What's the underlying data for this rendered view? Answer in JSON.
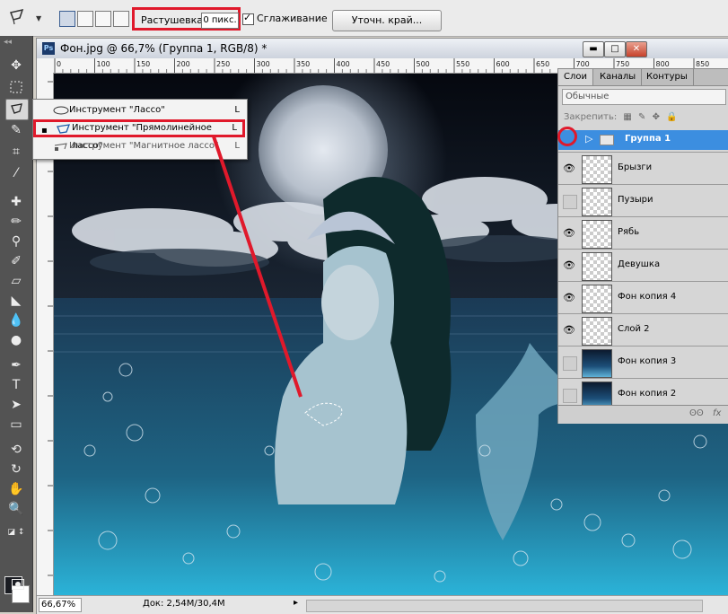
{
  "options_bar": {
    "feather_label": "Растушевка:",
    "feather_value": "0 пикс.",
    "antialias_label": "Сглаживание",
    "antialias_checked": true,
    "refine_edge_label": "Уточн. край..."
  },
  "document": {
    "title": "Фон.jpg @ 66,7% (Группа 1, RGB/8) *",
    "ruler_labels": [
      "0",
      "100",
      "150",
      "200",
      "250",
      "300",
      "350",
      "400",
      "450",
      "500",
      "550",
      "600",
      "650",
      "700",
      "750",
      "800",
      "850"
    ],
    "zoom": "66,67%",
    "doc_info": "Док: 2,54M/30,4M"
  },
  "tool_flyout": {
    "items": [
      {
        "label": "Инструмент \"Лассо\"",
        "shortcut": "L",
        "selected": false
      },
      {
        "label": "Инструмент \"Прямолинейное лассо\"",
        "shortcut": "L",
        "selected": true
      },
      {
        "label": "Инструмент \"Магнитное лассо\"",
        "shortcut": "L",
        "selected": false
      }
    ]
  },
  "layers_panel": {
    "tabs": [
      "Слои",
      "Каналы",
      "Контуры"
    ],
    "blend_mode": "Обычные",
    "lock_label": "Закрепить:",
    "group_name": "Группа 1",
    "layers": [
      {
        "name": "Брызги",
        "visible": true,
        "dark": false
      },
      {
        "name": "Пузыри",
        "visible": false,
        "dark": false
      },
      {
        "name": "Рябь",
        "visible": true,
        "dark": false
      },
      {
        "name": "Девушка",
        "visible": true,
        "dark": false
      },
      {
        "name": "Фон копия 4",
        "visible": true,
        "dark": false
      },
      {
        "name": "Слой 2",
        "visible": true,
        "dark": false
      },
      {
        "name": "Фон копия 3",
        "visible": false,
        "dark": true
      },
      {
        "name": "Фон копия 2",
        "visible": false,
        "dark": true
      }
    ],
    "footer_link": "ʘʘ",
    "footer_fx": "fx"
  },
  "colors": {
    "highlight_red": "#e0192b",
    "selection_blue": "#3c8ee0",
    "toolbox_gray": "#535353"
  }
}
